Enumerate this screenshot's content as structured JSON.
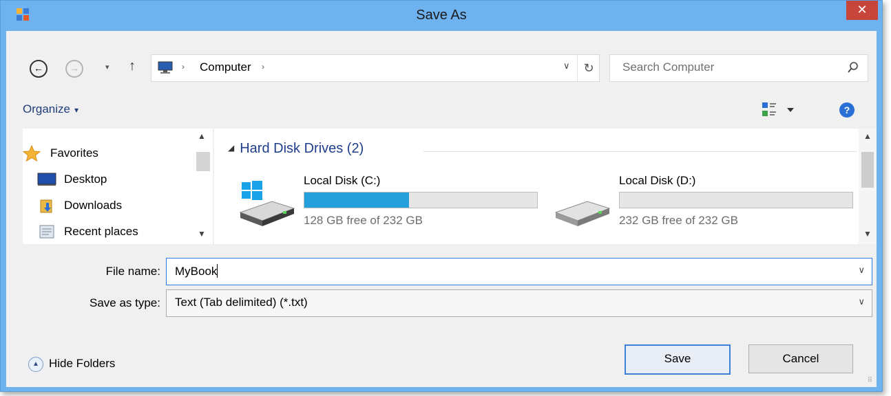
{
  "window": {
    "title": "Save As",
    "close_label": "✕"
  },
  "nav": {
    "back_label": "←",
    "forward_label": "→",
    "recent_label": "▾",
    "up_label": "↑",
    "address": {
      "path_item": "Computer",
      "separator": "›",
      "dropdown": "∨",
      "refresh": "↻"
    },
    "search": {
      "placeholder": "Search Computer"
    }
  },
  "toolbar": {
    "organize_label": "Organize",
    "organize_caret": "▾",
    "help_label": "?"
  },
  "sidebar": {
    "items": [
      {
        "label": "Favorites",
        "icon": "star-icon"
      },
      {
        "label": "Desktop",
        "icon": "desktop-icon"
      },
      {
        "label": "Downloads",
        "icon": "downloads-icon"
      },
      {
        "label": "Recent places",
        "icon": "recent-places-icon"
      }
    ]
  },
  "content": {
    "group_caret": "◢",
    "group_title": "Hard Disk Drives (2)",
    "drives": [
      {
        "name": "Local Disk (C:)",
        "free_text": "128 GB free of 232 GB",
        "used_fraction": 0.45,
        "icon": "windows-drive-icon"
      },
      {
        "name": "Local Disk (D:)",
        "free_text": "232 GB free of 232 GB",
        "used_fraction": 0.0,
        "icon": "drive-icon"
      }
    ]
  },
  "form": {
    "filename_label": "File name:",
    "filename_value": "MyBook",
    "type_label": "Save as type:",
    "type_value": "Text (Tab delimited) (*.txt)",
    "dropdown_arrow": "∨"
  },
  "footer": {
    "hide_folders_icon": "▲",
    "hide_folders_label": "Hide Folders",
    "save_label": "Save",
    "cancel_label": "Cancel",
    "grip": "⠿"
  },
  "colors": {
    "accent": "#26a0da",
    "titlebar": "#6fb2f0",
    "close": "#c7453b",
    "link": "#1f3d8a"
  }
}
